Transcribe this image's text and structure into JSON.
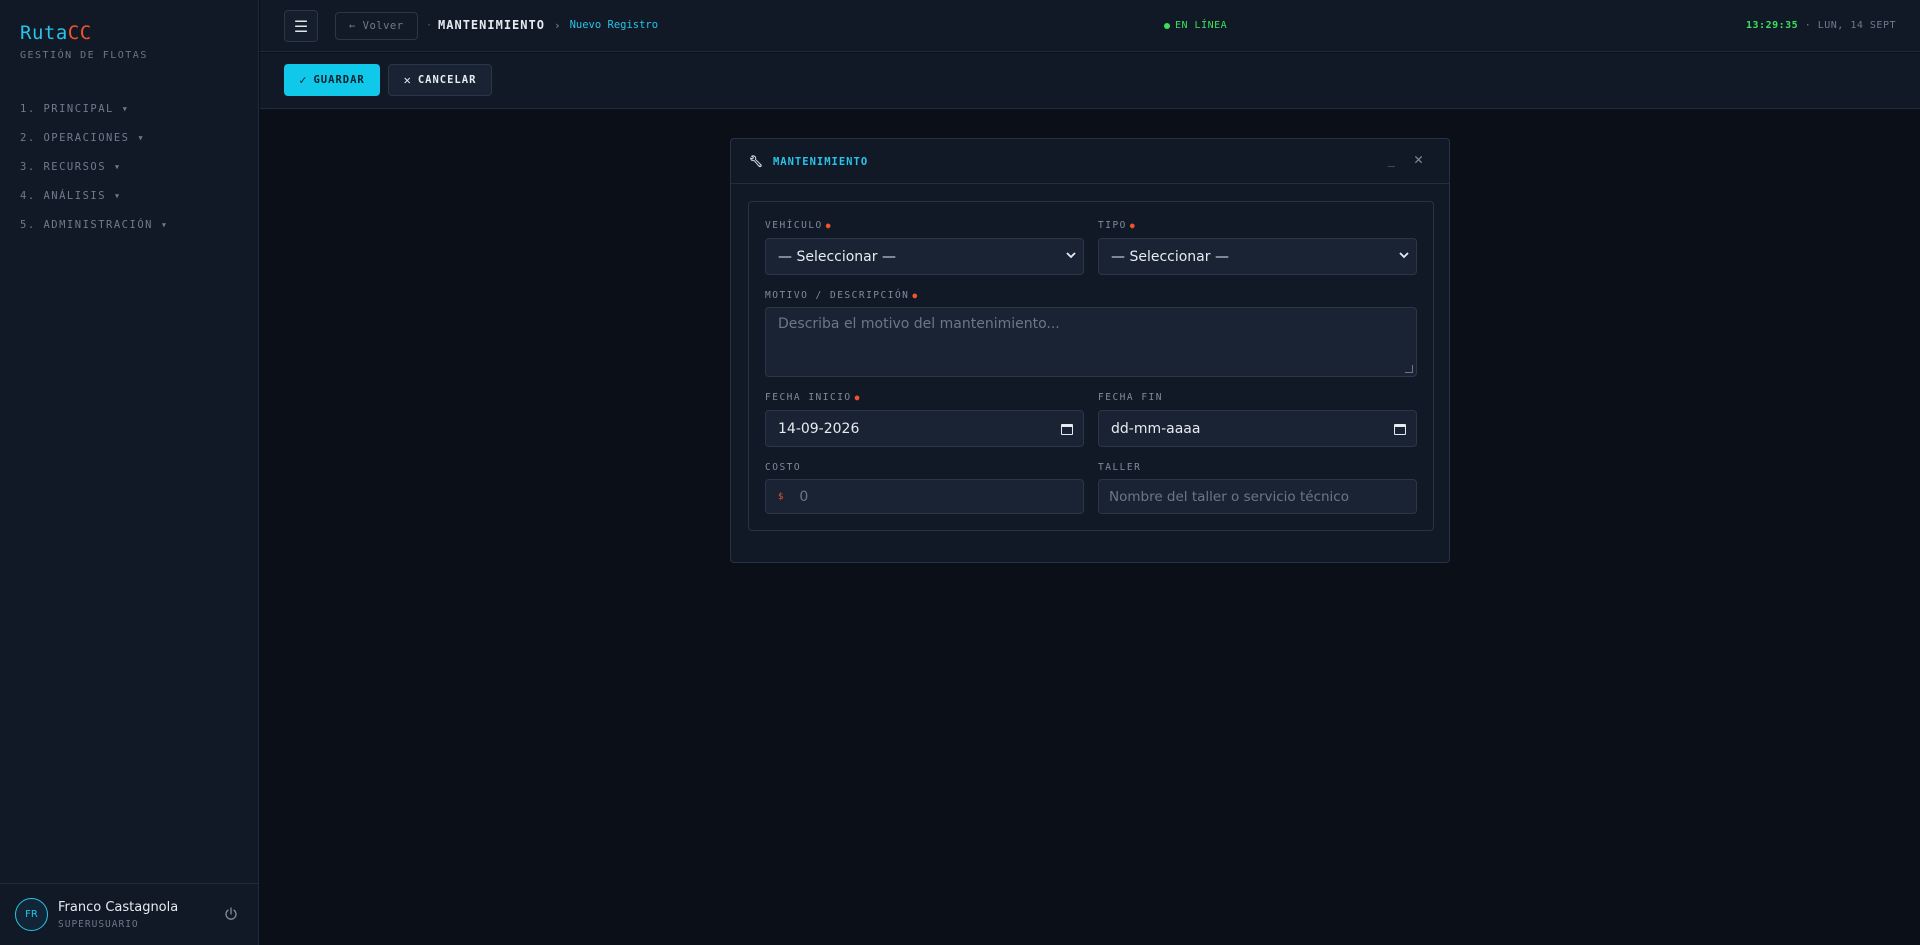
{
  "brand": {
    "name_a": "Ruta",
    "name_b": "CC",
    "subtitle": "GESTIÓN DE FLOTAS"
  },
  "nav": {
    "items": [
      {
        "label": "1. PRINCIPAL ▾"
      },
      {
        "label": "2. OPERACIONES ▾"
      },
      {
        "label": "3. RECURSOS ▾"
      },
      {
        "label": "4. ANÁLISIS ▾"
      },
      {
        "label": "5. ADMINISTRACIÓN ▾"
      }
    ]
  },
  "user": {
    "initials": "FR",
    "name": "Franco Castagnola",
    "role": "SUPERUSUARIO"
  },
  "topbar": {
    "menu_glyph": "☰",
    "back_label": "← Volver",
    "crumb_sep": "·",
    "crumb_main": "MANTENIMIENTO",
    "crumb_arrow": "›",
    "crumb_sub": "Nuevo Registro",
    "status": "EN LÍNEA",
    "time": "13:29:35",
    "date": " · LUN, 14 SEPT"
  },
  "actions": {
    "save_label": "GUARDAR",
    "cancel_label": "CANCELAR"
  },
  "modal": {
    "title": "MANTENIMIENTO",
    "fields": {
      "vehiculo": {
        "label": "VEHÍCULO",
        "value": "— Seleccionar —"
      },
      "tipo": {
        "label": "TIPO",
        "value": "— Seleccionar —"
      },
      "motivo": {
        "label": "MOTIVO / DESCRIPCIÓN",
        "placeholder": "Describa el motivo del mantenimiento..."
      },
      "fecha_inicio": {
        "label": "FECHA INICIO",
        "value": "14-09-2026"
      },
      "fecha_fin": {
        "label": "FECHA FIN",
        "value": "dd-mm-aaaa"
      },
      "costo": {
        "label": "COSTO",
        "currency": "$",
        "placeholder": "0"
      },
      "taller": {
        "label": "TALLER",
        "placeholder": "Nombre del taller o servicio técnico"
      }
    }
  },
  "colors": {
    "accent": "#27c4e8",
    "brand_secondary": "#f0532e",
    "online": "#3ce05b"
  }
}
